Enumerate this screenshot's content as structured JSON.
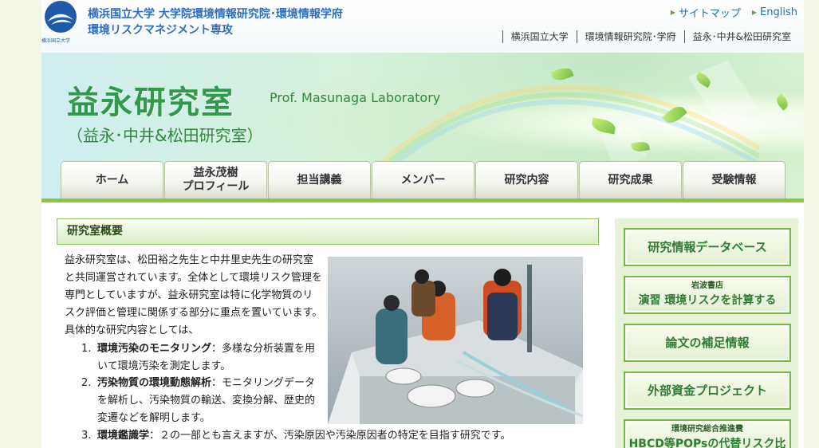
{
  "header": {
    "logo_caption": "横浜国立大学",
    "title_line1": "横浜国立大学 大学院環境情報研究院･環境情報学府",
    "title_line2": "環境リスクマネジメント専攻",
    "util_links": [
      {
        "label": "サイトマップ"
      },
      {
        "label": "English"
      }
    ],
    "global_links": [
      {
        "label": "横浜国立大学"
      },
      {
        "label": "環境情報研究院･学府"
      },
      {
        "label": "益永･中井&松田研究室"
      }
    ]
  },
  "banner": {
    "lab_title": "益永研究室",
    "lab_title_en": "Prof. Masunaga Laboratory",
    "lab_subtitle": "（益永･中井&松田研究室）"
  },
  "nav": {
    "tabs": [
      {
        "line1": "ホーム",
        "line2": ""
      },
      {
        "line1": "益永茂樹",
        "line2": "プロフィール"
      },
      {
        "line1": "担当講義",
        "line2": ""
      },
      {
        "line1": "メンバー",
        "line2": ""
      },
      {
        "line1": "研究内容",
        "line2": ""
      },
      {
        "line1": "研究成果",
        "line2": ""
      },
      {
        "line1": "受験情報",
        "line2": ""
      }
    ]
  },
  "main": {
    "section_title": "研究室概要",
    "intro": "益永研究室は、松田裕之先生と中井里史先生の研究室と共同運営されています。全体として環境リスク管理を専門としていますが、益永研究室は特に化学物質のリスク評価と管理に関係する部分に重点を置いています。具体的な研究内容としては、",
    "research_items": [
      {
        "number": "1.",
        "title": "環境汚染のモニタリング",
        "separator": "：",
        "description": "多様な分析装置を用いて環境汚染を測定します。"
      },
      {
        "number": "2.",
        "title": "汚染物質の環境動態解析",
        "separator": "：",
        "description": "モニタリングデータを解析し、汚染物質の輸送、変換分解、歴史的変遷などを解明します。"
      },
      {
        "number": "3.",
        "title": "環境鑑識学",
        "separator": "：",
        "description": "２の一部とも言えますが、汚染原因や汚染原因者の特定を目指す研究です。"
      }
    ]
  },
  "sidebar": {
    "database": "研究情報データベース",
    "book_publisher": "岩波書店",
    "book_title": "演習 環境リスクを計算する",
    "supplement": "論文の補足情報",
    "funding": "外部資金プロジェクト",
    "project_sponsor": "環境研究総合推進費",
    "project_title": "HBCD等POPsの代替リスク比較"
  },
  "colors": {
    "accent_green": "#8cc63f",
    "title_green": "#2e9a4a",
    "link_blue": "#2e6ec0"
  }
}
